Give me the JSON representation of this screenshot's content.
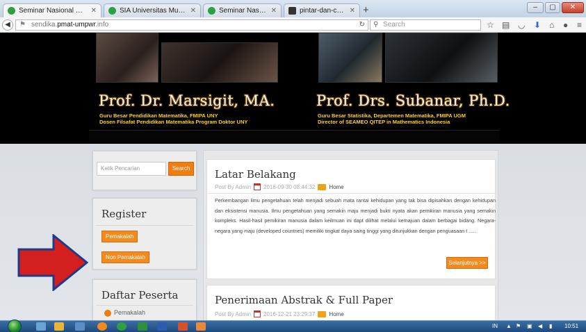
{
  "browser": {
    "tabs": [
      {
        "label": "Seminar Nasional Matemat...",
        "active": true
      },
      {
        "label": "SIA Universitas Muhamma...",
        "active": false
      },
      {
        "label": "Seminar Nasional Sains da...",
        "active": false
      },
      {
        "label": "pintar-dan-cerdas-adalah.j...",
        "active": false
      }
    ],
    "url_prefix": "sendika.",
    "url_host": "pmat-umpwr",
    "url_suffix": ".info",
    "search_placeholder": "Search"
  },
  "header": {
    "left_name": "Prof. Dr. Marsigit, MA.",
    "left_line1": "Guru Besar Pendidikan Matematika, FMIPA UNY",
    "left_line2": "Dosen Filsafat Pendidikan Matematika Program Doktor UNY",
    "right_name": "Prof. Drs. Subanar, Ph.D.",
    "right_line1": "Guru Besar Statistika, Departemen Matematika, FMIPA UGM",
    "right_line2": "Director of SEAMEO QITEP in Mathematics Indonesia"
  },
  "sidebar": {
    "search_placeholder": "Ketik Pencarian",
    "search_button": "Search",
    "register_title": "Register",
    "pemakalah_button": "Pemakalah",
    "non_pemakalah_button": "Non Pemakalah",
    "peserta_title": "Daftar Peserta",
    "peserta_item": "Pemakalah"
  },
  "posts": [
    {
      "title": "Latar Belakang",
      "by": "Post By Admin",
      "date": "2016-09-30 08:44:32",
      "category": "Home",
      "body": "Perkembangan ilmu pengetahuan telah menjadi sebuah mata rantai kehidupan yang tak bisa dipisahkan dengan kehidupan dan eksistensi manusia. Ilmu pengetahuan yang semakin maju menjadi bukti nyata akan pemikiran manusia yang semakin kompleks. Hasil-hasil pemikiran manusia dalam keilmuan ini dapt dilihat melalui kemajuan dalam berbagai bidang. Negara-negara yang maju (developed countries) memiliki tingkat daya saing tinggi yang ditunjukkan dengan penguasaan t .....",
      "more": "Selanjutnya >>"
    },
    {
      "title": "Penerimaan Abstrak & Full Paper",
      "by": "Post By Admin",
      "date": "2016-12-21 23:29:37",
      "category": "Home"
    }
  ],
  "taskbar": {
    "lang": "IN",
    "time": "10:51"
  },
  "colors": {
    "accent": "#f28a1e",
    "arrow_fill": "#d41f1f",
    "arrow_stroke": "#1f3a8a"
  }
}
